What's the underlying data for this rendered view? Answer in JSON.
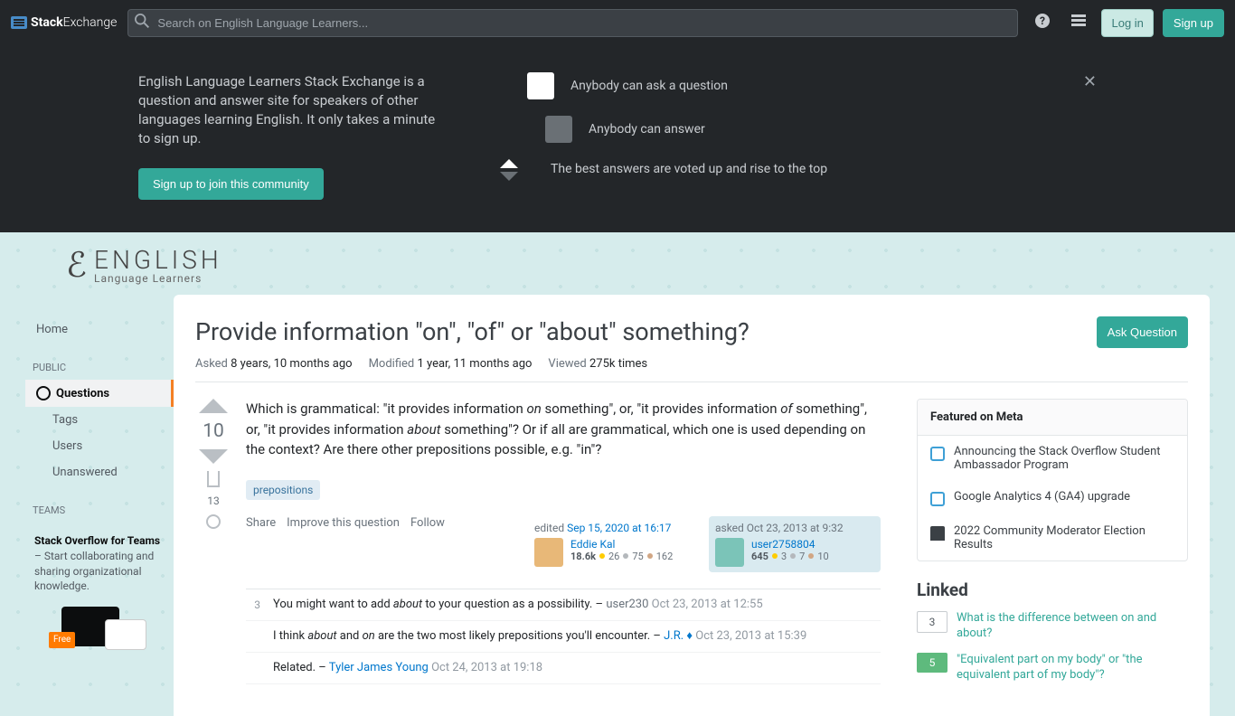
{
  "topbar": {
    "brand_a": "Stack",
    "brand_b": "Exchange",
    "search_placeholder": "Search on English Language Learners...",
    "login": "Log in",
    "signup": "Sign up"
  },
  "hero": {
    "blurb": "English Language Learners Stack Exchange is a question and answer site for speakers of other languages learning English. It only takes a minute to sign up.",
    "join": "Sign up to join this community",
    "ask": "Anybody can ask a question",
    "answer": "Anybody can answer",
    "best": "The best answers are voted up and rise to the top"
  },
  "site_logo": {
    "main": "ENGLISH",
    "sub": "Language Learners"
  },
  "nav": {
    "home": "Home",
    "public": "PUBLIC",
    "questions": "Questions",
    "tags": "Tags",
    "users": "Users",
    "unanswered": "Unanswered",
    "teams": "TEAMS",
    "teams_promo_bold": "Stack Overflow for Teams",
    "teams_promo_rest": " – Start collaborating and sharing organizational knowledge.",
    "free": "Free"
  },
  "question": {
    "title": "Provide information \"on\", \"of\" or \"about\" something?",
    "ask_btn": "Ask Question",
    "asked_label": "Asked",
    "asked_val": "8 years, 10 months ago",
    "modified_label": "Modified",
    "modified_val": "1 year, 11 months ago",
    "viewed_label": "Viewed",
    "viewed_val": "275k times",
    "score": "10",
    "bookmark_count": "13",
    "body_html": "Which is grammatical: \"it provides information <em>on</em> something\", or, \"it provides information <em>of</em> something\", or, \"it provides information <em>about</em> something\"? Or if all are grammatical, which one is used depending on the context? Are there other prepositions possible, e.g. \"in\"?",
    "tag": "prepositions",
    "actions": {
      "share": "Share",
      "improve": "Improve this question",
      "follow": "Follow"
    },
    "editor": {
      "label": "edited ",
      "time": "Sep 15, 2020 at 16:17",
      "name": "Eddie Kal",
      "rep": "18.6k",
      "gold": "26",
      "silver": "75",
      "bronze": "162"
    },
    "asker": {
      "label": "asked ",
      "time": "Oct 23, 2013 at 9:32",
      "name": "user2758804",
      "rep": "645",
      "gold": "3",
      "silver": "7",
      "bronze": "10"
    }
  },
  "comments": [
    {
      "score": "3",
      "text": "You might want to add <em>about</em> to your question as a possibility.",
      "sep": " – ",
      "author": "user230",
      "author_gray": true,
      "time": "Oct 23, 2013 at 12:55"
    },
    {
      "score": "",
      "text": "I think <em>about</em> and <em>on</em> are the two most likely prepositions you'll encounter.",
      "sep": " – ",
      "author": "J.R. ♦",
      "author_gray": false,
      "time": "Oct 23, 2013 at 15:39"
    },
    {
      "score": "",
      "text": "Related.",
      "sep": " – ",
      "author": "Tyler James Young",
      "author_gray": false,
      "time": "Oct 24, 2013 at 19:18"
    }
  ],
  "sidebar": {
    "featured": "Featured on Meta",
    "meta_items": [
      "Announcing the Stack Overflow Student Ambassador Program",
      "Google Analytics 4 (GA4) upgrade",
      "2022 Community Moderator Election Results"
    ],
    "linked": "Linked",
    "linked_items": [
      {
        "score": "3",
        "green": false,
        "title": "What is the difference between on and about?"
      },
      {
        "score": "5",
        "green": true,
        "title": "\"Equivalent part on my body\" or \"the equivalent part of my body\"?"
      }
    ]
  }
}
